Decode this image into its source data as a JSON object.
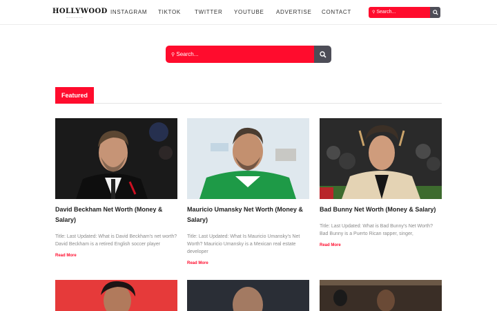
{
  "header": {
    "logo_text": "HOLLYWOOD",
    "nav": [
      "INSTAGRAM",
      "TIKTOK",
      "TWITTER",
      "YOUTUBE",
      "ADVERTISE",
      "CONTACT"
    ],
    "search_placeholder": "Search..."
  },
  "main_search": {
    "placeholder": "Search..."
  },
  "featured": {
    "label": "Featured"
  },
  "colors": {
    "accent": "#ff0c2d",
    "search_button": "#4d4d57"
  },
  "posts": [
    {
      "title": "David Beckham Net Worth (Money & Salary)",
      "excerpt": "Title: Last Updated: What is David Beckham's net worth? David Beckham is a retired English soccer player",
      "read_more": "Read More"
    },
    {
      "title": "Mauricio Umansky Net Worth (Money & Salary)",
      "excerpt": "Title: Last Updated: What Is Mauricio Umansky's Net Worth? Mauricio Umansky is a Mexican real estate developer",
      "read_more": "Read More"
    },
    {
      "title": "Bad Bunny Net Worth (Money & Salary)",
      "excerpt": "Title: Last Updated: What is Bad Bunny's Net Worth? Bad Bunny is a Puerto Rican rapper, singer,",
      "read_more": "Read More"
    }
  ]
}
